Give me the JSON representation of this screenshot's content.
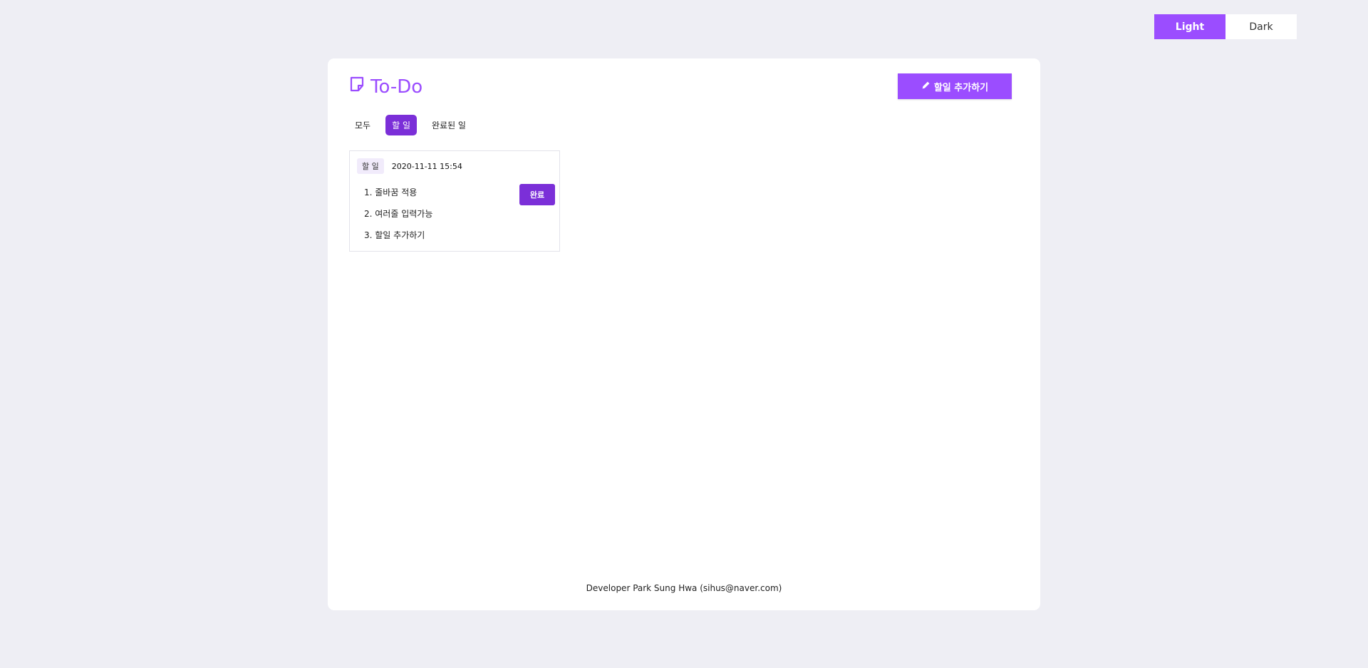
{
  "theme_toggle": {
    "light_label": "Light",
    "dark_label": "Dark",
    "selected": "Light"
  },
  "app": {
    "title": "To-Do",
    "add_button_label": "할일 추가하기"
  },
  "tabs": [
    {
      "label": "모두",
      "active": false
    },
    {
      "label": "할 일",
      "active": true
    },
    {
      "label": "완료된 일",
      "active": false
    }
  ],
  "todo_card": {
    "status": "할 일",
    "date": "2020-11-11 15:54",
    "items": [
      "1. 줄바꿈 적용",
      "2. 여러줄 입력가능",
      "3. 할일 추가하기"
    ],
    "done_button_label": "완료"
  },
  "footer": {
    "text": "Developer Park Sung Hwa (sihus@naver.com)"
  },
  "colors": {
    "accent": "#9b4dff",
    "accent_dark": "#7b2fd8",
    "background": "#eeeef4"
  },
  "icons": {
    "title_icon": "sticky-note-icon",
    "add_icon": "pencil-icon"
  }
}
